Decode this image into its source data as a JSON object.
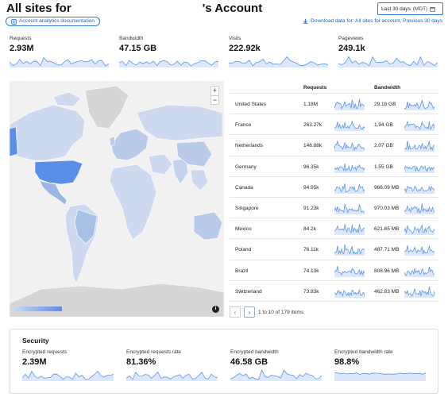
{
  "header": {
    "title_prefix": "All sites for",
    "title_suffix": "'s Account",
    "doc_button": "Account analytics documentation",
    "date_range": "Last 30 days",
    "timezone": "(MDT)",
    "download_link": "Download data for: All sites for account, Previous 30 days"
  },
  "stats": [
    {
      "label": "Requests",
      "value": "2.93M"
    },
    {
      "label": "Bandwidth",
      "value": "47.15 GB"
    },
    {
      "label": "Visits",
      "value": "222.92k"
    },
    {
      "label": "Pageviews",
      "value": "249.1k"
    }
  ],
  "map": {
    "zoom_in": "+",
    "zoom_out": "−",
    "info": "i"
  },
  "table": {
    "headers": {
      "country": "",
      "requests": "Requests",
      "bandwidth": "Bandwidth"
    },
    "rows": [
      {
        "country": "United States",
        "requests": "1.18M",
        "bandwidth": "29.18 GB"
      },
      {
        "country": "France",
        "requests": "263.27k",
        "bandwidth": "1.94 GB"
      },
      {
        "country": "Netherlands",
        "requests": "146.88k",
        "bandwidth": "2.07 GB"
      },
      {
        "country": "Germany",
        "requests": "96.35k",
        "bandwidth": "1.55 GB"
      },
      {
        "country": "Canada",
        "requests": "94.95k",
        "bandwidth": "966.09 MB"
      },
      {
        "country": "Singapore",
        "requests": "91.23k",
        "bandwidth": "970.03 MB"
      },
      {
        "country": "Mexico",
        "requests": "84.2k",
        "bandwidth": "621.65 MB"
      },
      {
        "country": "Poland",
        "requests": "76.11k",
        "bandwidth": "487.71 MB"
      },
      {
        "country": "Brazil",
        "requests": "74.13k",
        "bandwidth": "808.96 MB"
      },
      {
        "country": "Switzerland",
        "requests": "73.83k",
        "bandwidth": "462.83 MB"
      }
    ],
    "pager": {
      "prev": "‹",
      "next": "›",
      "summary": "1 to 10 of 179 items"
    }
  },
  "security": {
    "title": "Security",
    "stats": [
      {
        "label": "Encrypted requests",
        "value": "2.39M"
      },
      {
        "label": "Encrypted requests rate",
        "value": "81.36%"
      },
      {
        "label": "Encrypted bandwidth",
        "value": "46.58 GB"
      },
      {
        "label": "Encrypted bandwidth rate",
        "value": "98.8%"
      }
    ]
  },
  "colors": {
    "accent": "#2b7be0",
    "spark": "#5b95e8",
    "spark_fill": "#dce8fa",
    "map_land": "#cdd9ee",
    "map_dark": "#5b8ee6",
    "map_none": "#d6d6d6"
  }
}
